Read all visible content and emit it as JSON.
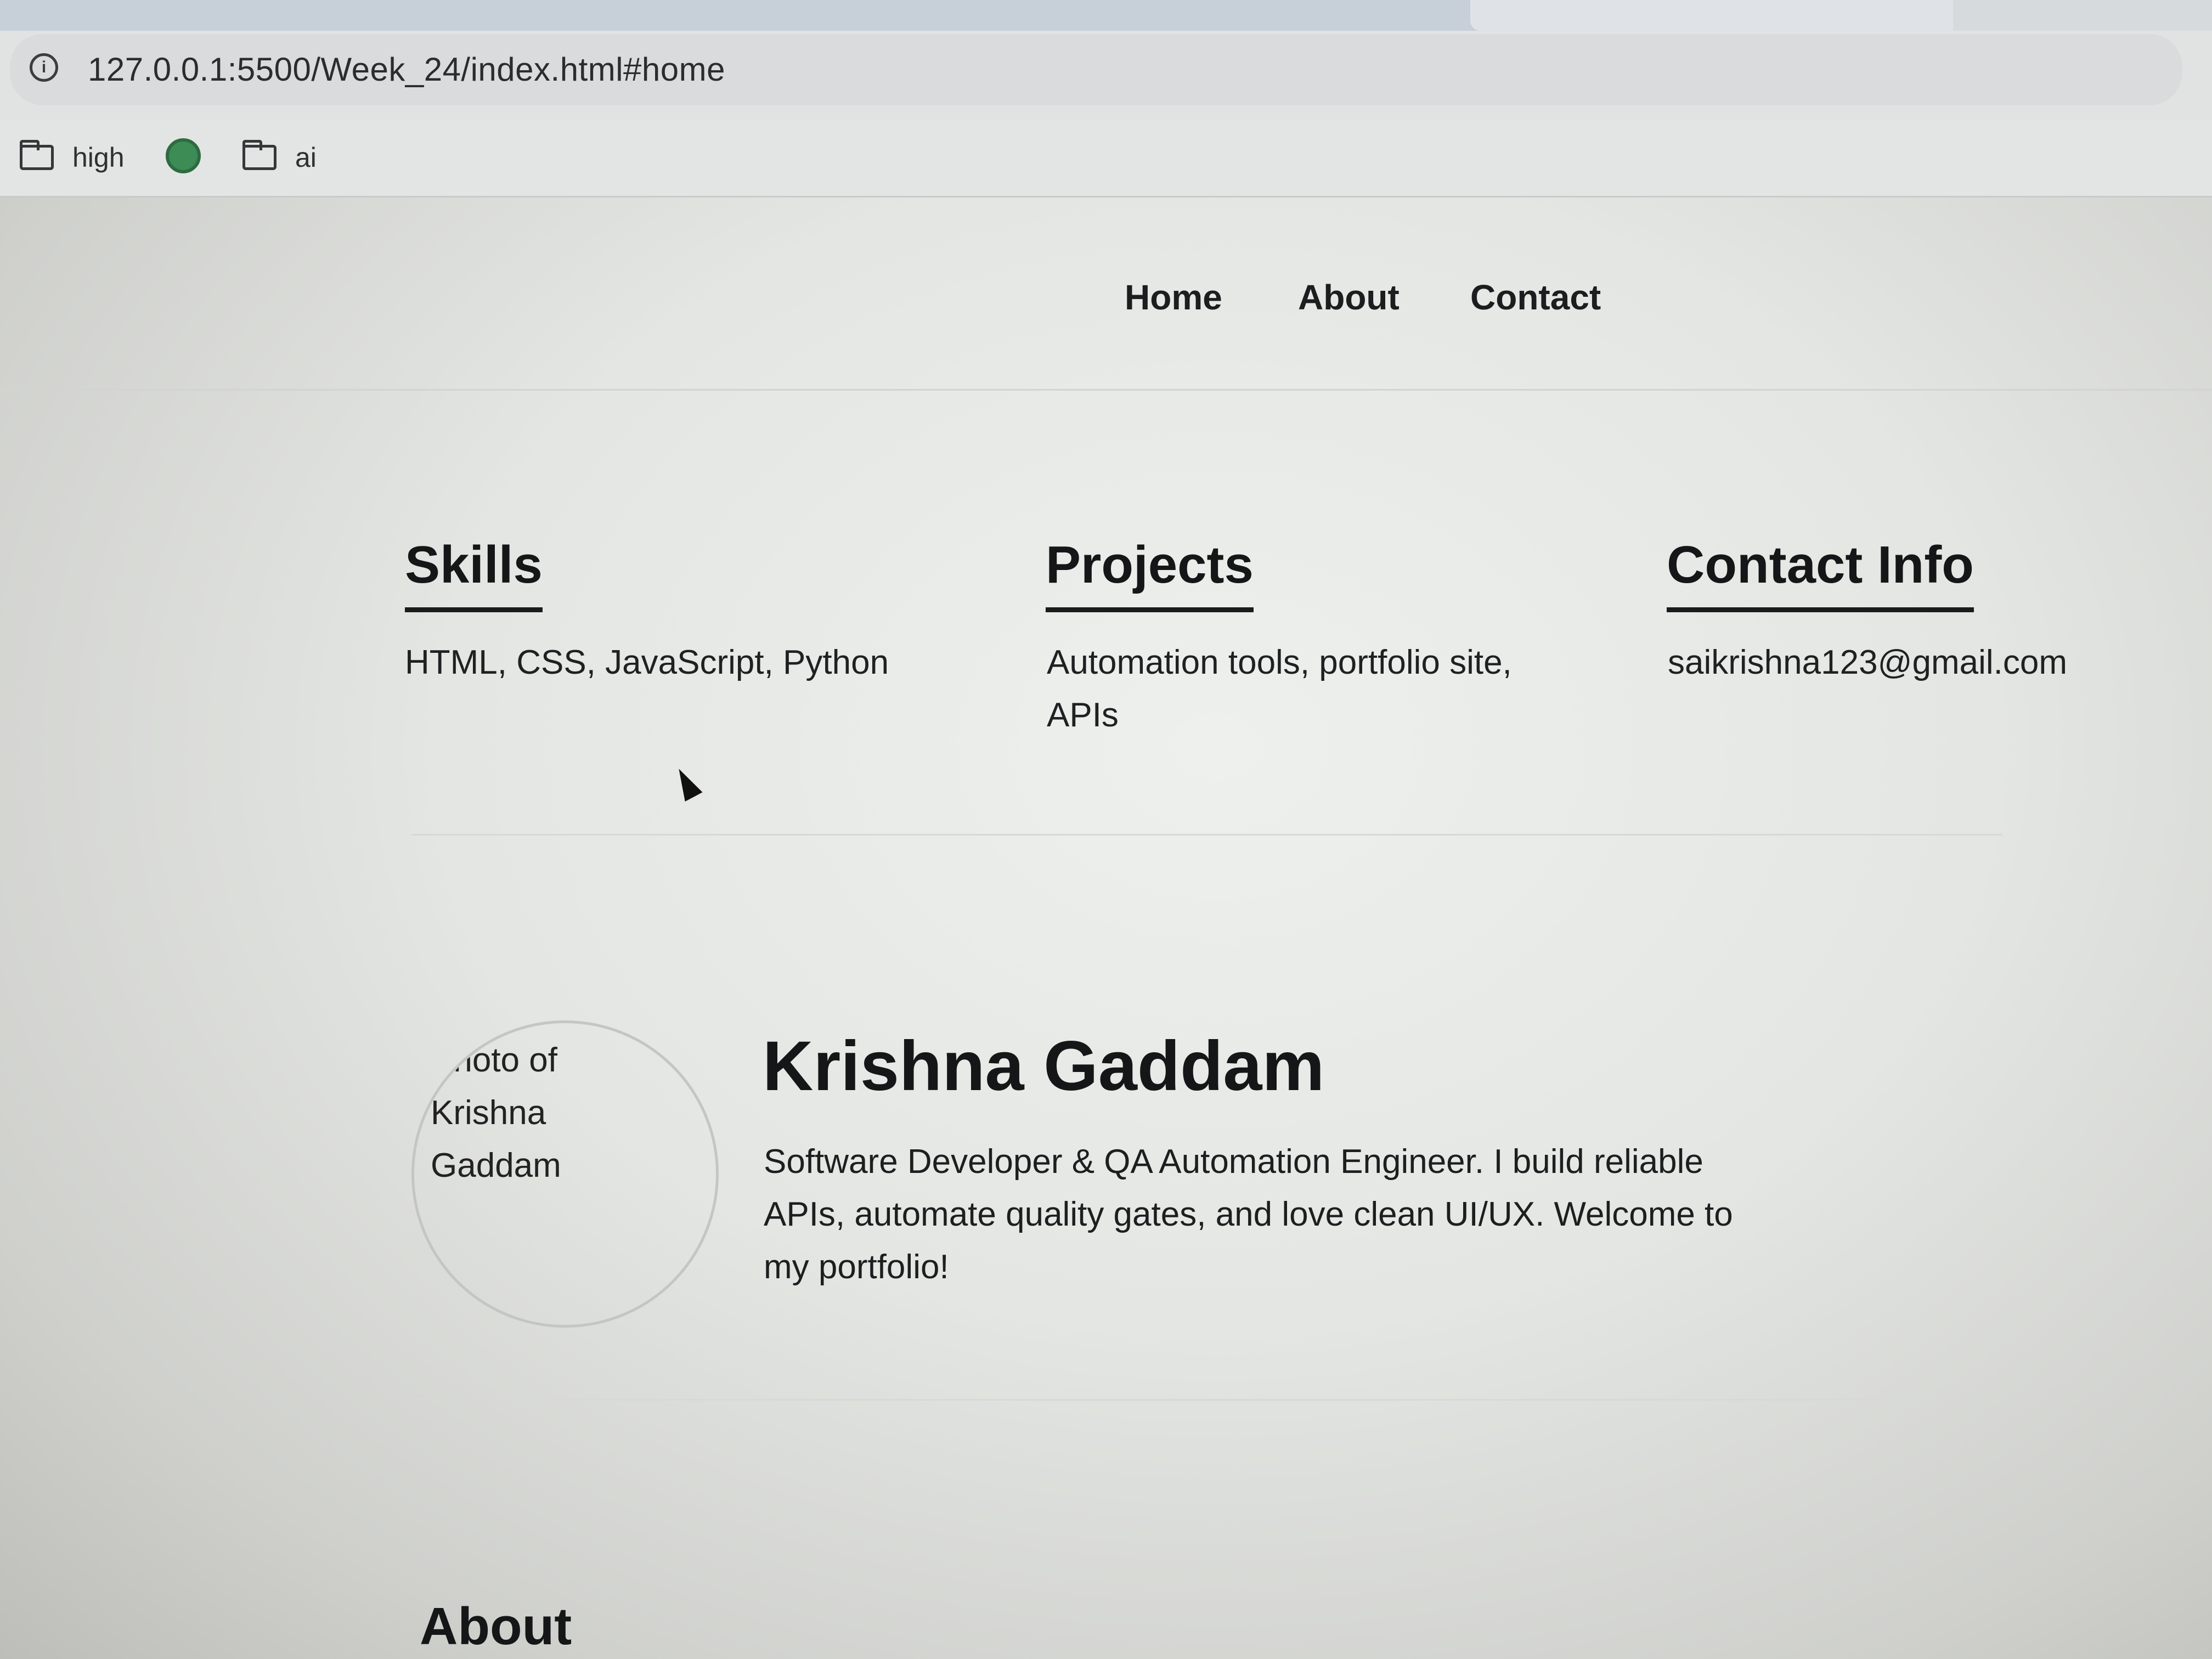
{
  "browser": {
    "url": "127.0.0.1:5500/Week_24/index.html#home",
    "bookmarks": [
      {
        "label": "high",
        "icon": "folder-icon"
      },
      {
        "label": "",
        "icon": "site-favicon"
      },
      {
        "label": "ai",
        "icon": "folder-icon"
      }
    ]
  },
  "nav": {
    "items": [
      "Home",
      "About",
      "Contact"
    ]
  },
  "columns": [
    {
      "heading": "Skills",
      "text": "HTML, CSS, JavaScript, Python"
    },
    {
      "heading": "Projects",
      "text": "Automation tools, portfolio site, APIs"
    },
    {
      "heading": "Contact Info",
      "text": "saikrishna123@gmail.com"
    }
  ],
  "hero": {
    "photo_alt": "Photo of Krishna Gaddam",
    "name": "Krishna Gaddam",
    "bio": "Software Developer & QA Automation Engineer. I build reliable APIs, automate quality gates, and love clean UI/UX. Welcome to my portfolio!"
  },
  "about": {
    "heading": "About"
  }
}
